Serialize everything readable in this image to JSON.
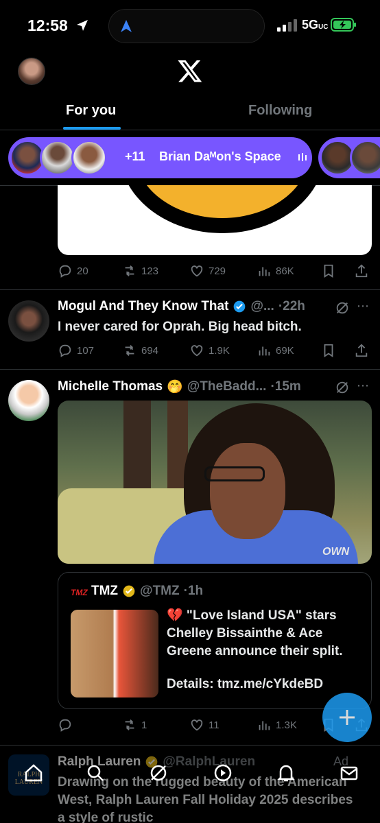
{
  "status_bar": {
    "time": "12:58",
    "network": "5G",
    "network_suffix": "UC"
  },
  "header": {
    "tabs": [
      {
        "label": "For you",
        "active": true
      },
      {
        "label": "Following",
        "active": false
      }
    ],
    "accent_color": "#1d9bf0"
  },
  "spaces": {
    "extra_count": "+11",
    "title": "Brian Daᴹon's Space",
    "color": "#7856ff"
  },
  "tweet0": {
    "stats": {
      "replies": "20",
      "reposts": "123",
      "likes": "729",
      "views": "86K"
    }
  },
  "tweet1": {
    "name": "Mogul And They Know That",
    "handle": "@...",
    "time": "·22h",
    "text": "I never cared for Oprah. Big head bitch.",
    "stats": {
      "replies": "107",
      "reposts": "694",
      "likes": "1.9K",
      "views": "69K"
    }
  },
  "tweet2": {
    "name": "Michelle Thomas",
    "emoji": "🤭",
    "handle": "@TheBadd...",
    "time": "·15m",
    "media_watermark": "OWN",
    "quote": {
      "logo": "TMZ",
      "name": "TMZ",
      "handle": "@TMZ",
      "time": "·1h",
      "text_line1": "💔 \"Love Island USA\" stars Chelley Bissainthe & Ace Greene announce their split.",
      "text_line2": "Details: tmz.me/cYkdeBD"
    },
    "stats": {
      "replies": "",
      "reposts": "1",
      "likes": "11",
      "views": "1.3K"
    }
  },
  "ad_tweet": {
    "name": "Ralph Lauren",
    "handle": "@RalphLauren",
    "ad_label": "Ad",
    "avatar_text": "RALPH LAUREN",
    "text": "Drawing on the rugged beauty of the American West, Ralph Lauren Fall Holiday 2025 describes a style of rustic"
  },
  "bottom_nav": [
    "home-icon",
    "search-icon",
    "grok-icon",
    "spaces-icon",
    "notifications-icon",
    "messages-icon"
  ]
}
